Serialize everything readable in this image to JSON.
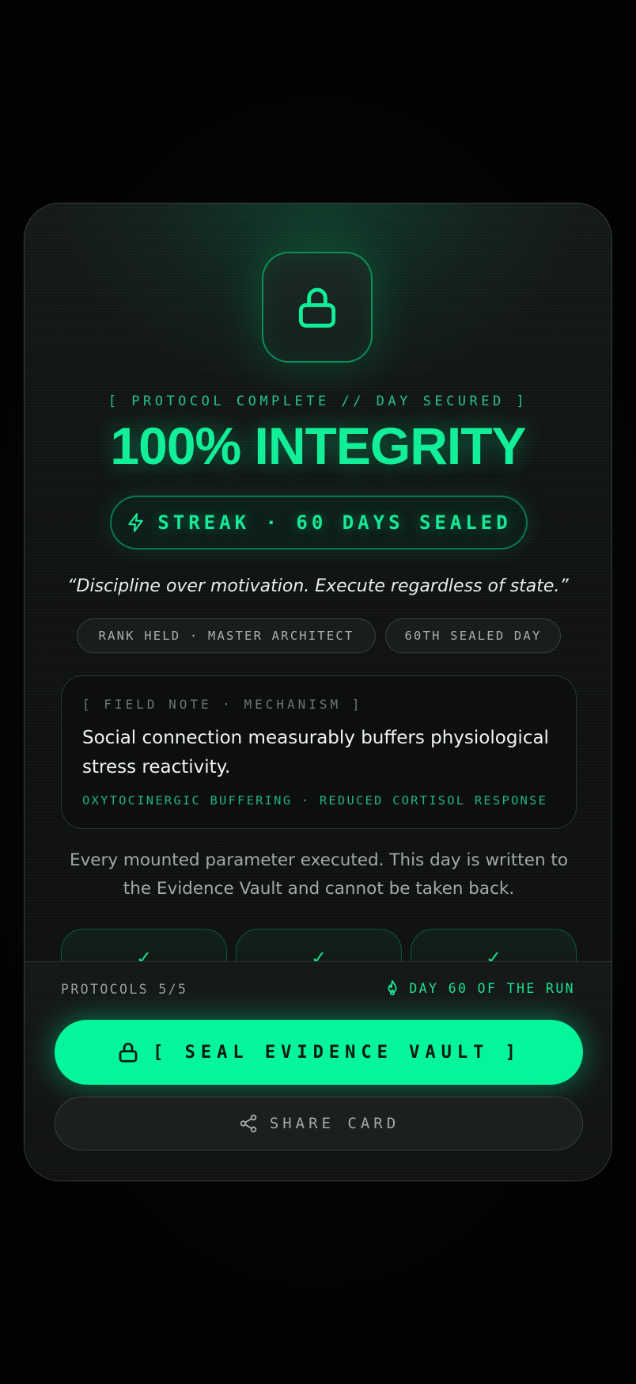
{
  "colors": {
    "accent": "#05f59a",
    "accent_text": "#19e896",
    "background": "#030404",
    "card": "#111414"
  },
  "icons": {
    "hero": "lock-icon",
    "streak": "bolt-icon",
    "run": "flame-icon",
    "seal": "lock-icon",
    "share": "share-icon",
    "protocol": "check-icon"
  },
  "header": {
    "eyebrow": "[ PROTOCOL COMPLETE // DAY SECURED ]",
    "headline": "100% INTEGRITY",
    "streak": "STREAK · 60 DAYS SEALED"
  },
  "quote": "“Discipline over motivation. Execute regardless of state.”",
  "chips": {
    "rank": "RANK HELD · MASTER ARCHITECT",
    "day": "60TH SEALED DAY"
  },
  "field_note": {
    "label": "[ FIELD NOTE · MECHANISM ]",
    "body": "Social connection measurably buffers physiological stress reactivity.",
    "mechanism": "OXYTOCINERGIC BUFFERING · REDUCED CORTISOL RESPONSE"
  },
  "summary": "Every mounted parameter executed. This day is written to the Evidence Vault and cannot be taken back.",
  "protocols": [
    {
      "check": "✓"
    },
    {
      "check": "✓"
    },
    {
      "check": "✓"
    }
  ],
  "footer": {
    "protocols": "PROTOCOLS 5/5",
    "run_day": "DAY 60 OF THE RUN",
    "seal_label": "[ SEAL EVIDENCE VAULT ]",
    "share_label": "SHARE CARD"
  }
}
